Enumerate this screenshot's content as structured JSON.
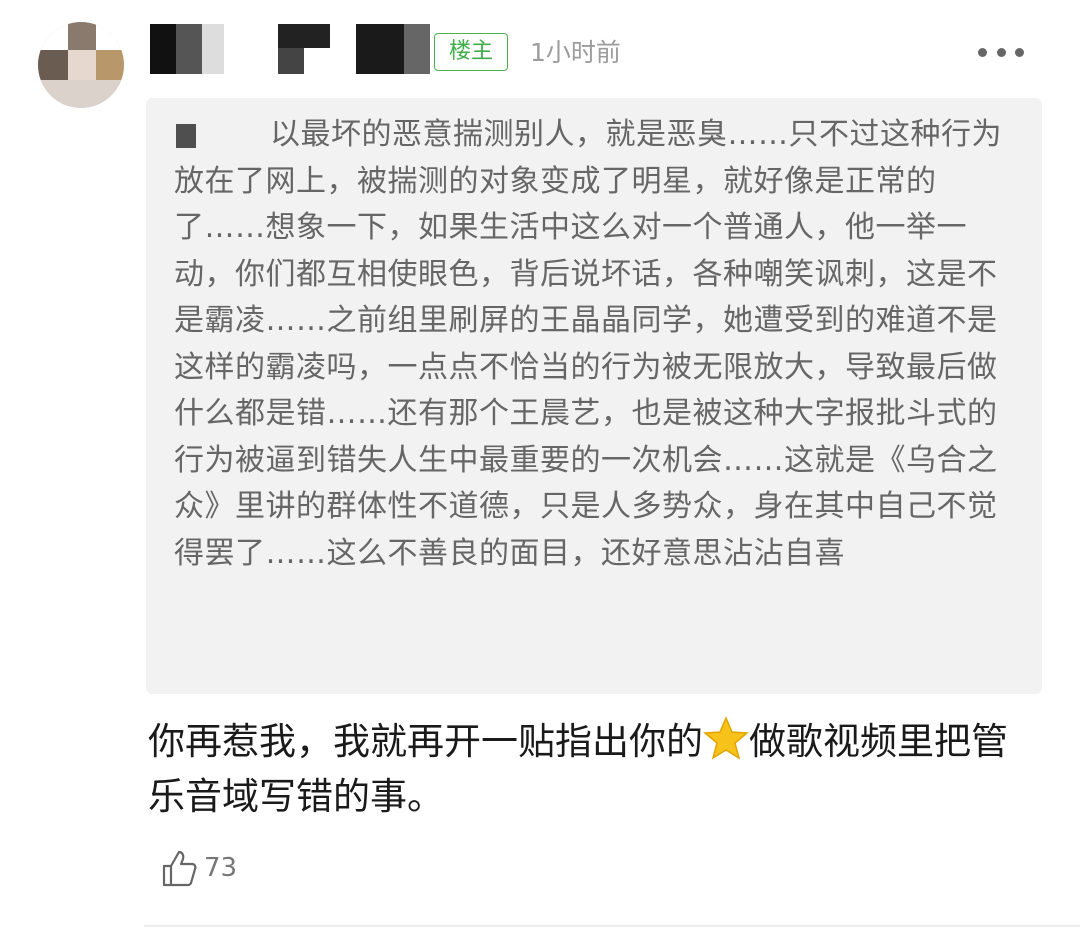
{
  "post": {
    "badge": "楼主",
    "time": "1小时前",
    "more_icon": "more-horizontal-icon",
    "quote": "以最坏的恶意揣测别人，就是恶臭……只不过这种行为放在了网上，被揣测的对象变成了明星，就好像是正常的了……想象一下，如果生活中这么对一个普通人，他一举一动，你们都互相使眼色，背后说坏话，各种嘲笑讽刺，这是不是霸凌……之前组里刷屏的王晶晶同学，她遭受到的难道不是这样的霸凌吗，一点点不恰当的行为被无限放大，导致最后做什么都是错……还有那个王晨艺，也是被这种大字报批斗式的行为被逼到错失人生中最重要的一次机会……这就是《乌合之众》里讲的群体性不道德，只是人多势众，身在其中自己不觉得罢了……这么不善良的面目，还好意思沾沾自喜",
    "reply_part1": "你再惹我，我就再开一贴指出你的",
    "reply_icon": "star-emoji-icon",
    "reply_part2": "做歌视频里把管乐音域写错的事。",
    "like_icon": "thumbs-up-icon",
    "like_count": "73"
  },
  "colors": {
    "badge_green": "#3fae49",
    "quote_bg": "#f2f2f2",
    "star_yellow": "#f7c21a"
  }
}
